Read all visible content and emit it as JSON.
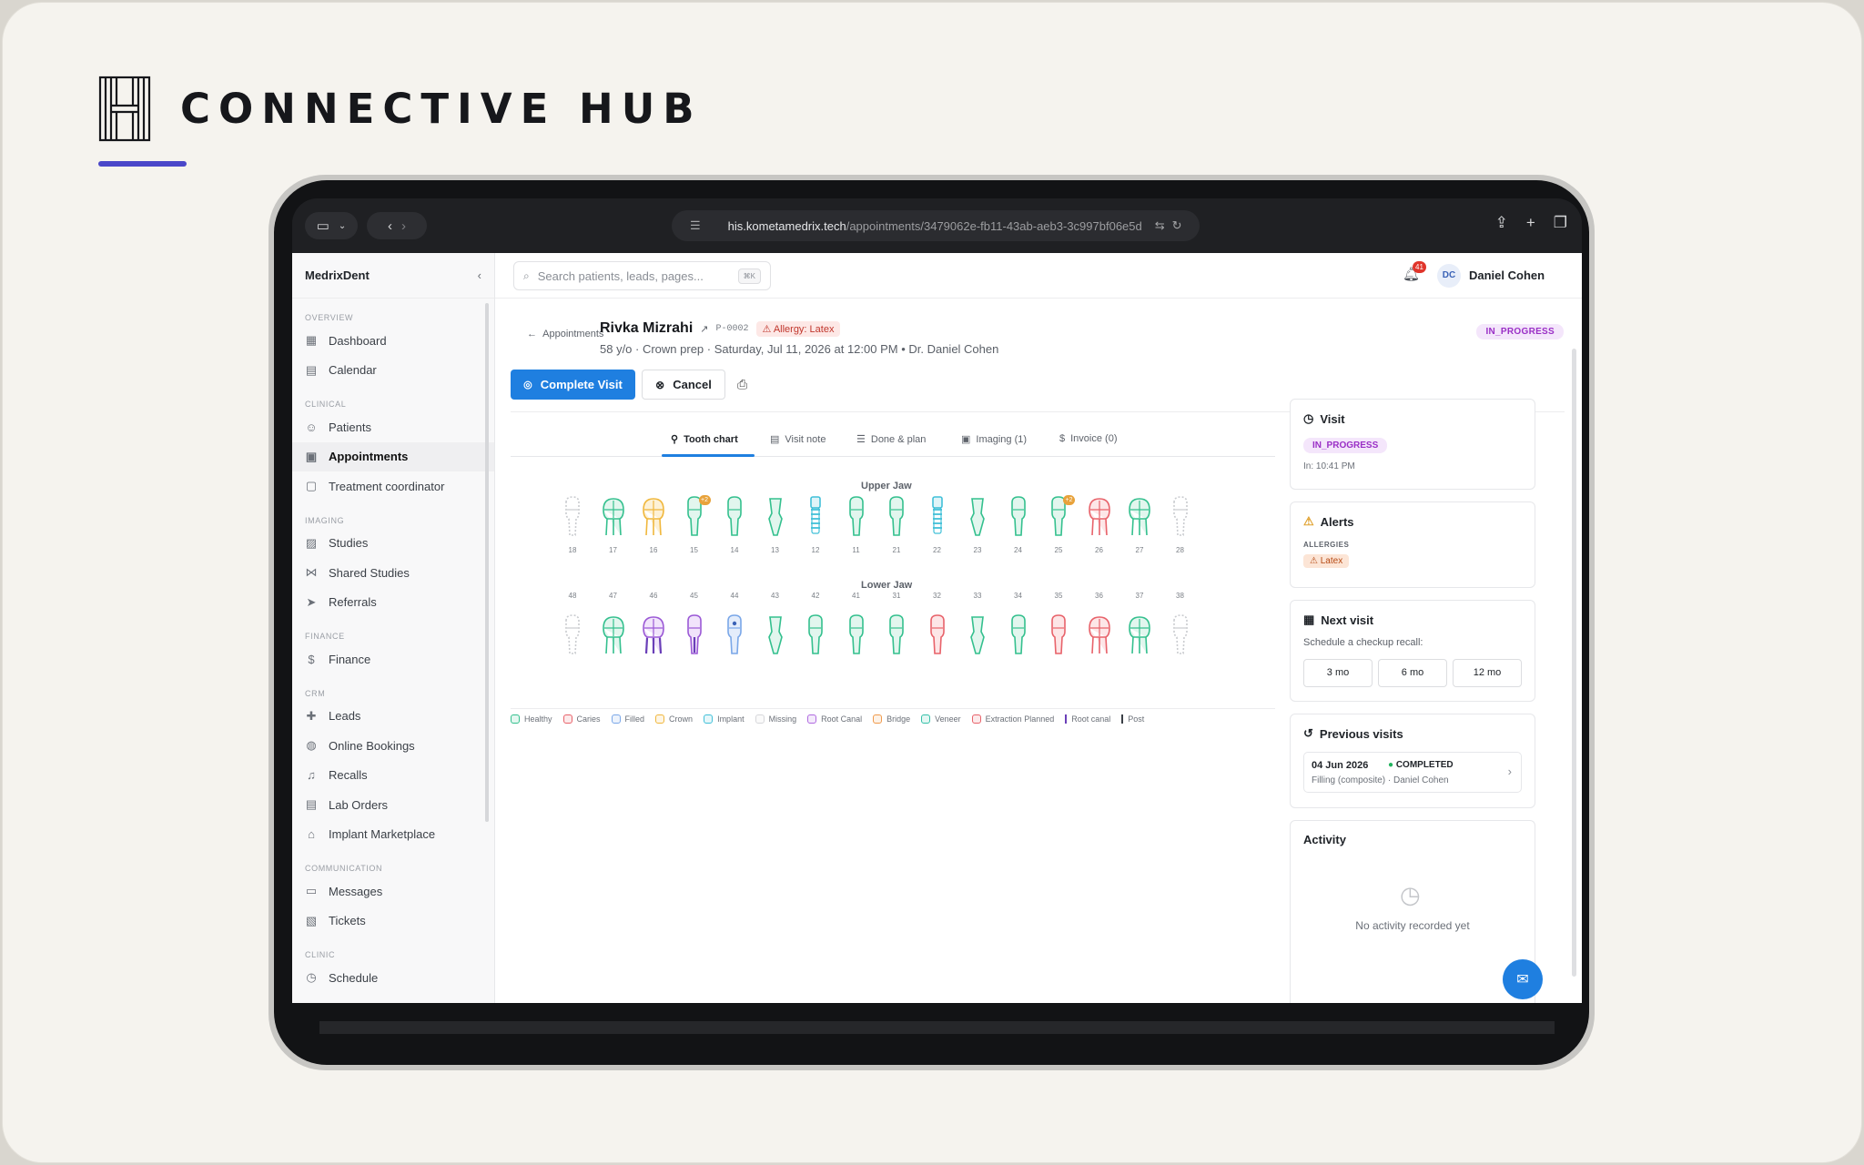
{
  "brand": {
    "name": "CONNECTIVE HUB",
    "underline_color": "#4a47c9"
  },
  "browser": {
    "url_host": "his.kometamedrix.tech",
    "url_path": "/appointments/3479062e-fb11-43ab-aeb3-3c997bf06e5d"
  },
  "sidebar": {
    "title": "MedrixDent",
    "sections": [
      {
        "label": "OVERVIEW",
        "items": [
          {
            "label": "Dashboard",
            "icon": "grid-icon"
          },
          {
            "label": "Calendar",
            "icon": "calendar-icon"
          }
        ]
      },
      {
        "label": "CLINICAL",
        "items": [
          {
            "label": "Patients",
            "icon": "users-icon"
          },
          {
            "label": "Appointments",
            "icon": "clipboard-icon",
            "active": true
          },
          {
            "label": "Treatment coordinator",
            "icon": "document-icon"
          }
        ]
      },
      {
        "label": "IMAGING",
        "items": [
          {
            "label": "Studies",
            "icon": "image-icon"
          },
          {
            "label": "Shared Studies",
            "icon": "share-icon"
          },
          {
            "label": "Referrals",
            "icon": "send-icon"
          }
        ]
      },
      {
        "label": "FINANCE",
        "items": [
          {
            "label": "Finance",
            "icon": "dollar-icon"
          }
        ]
      },
      {
        "label": "CRM",
        "items": [
          {
            "label": "Leads",
            "icon": "user-plus-icon"
          },
          {
            "label": "Online Bookings",
            "icon": "globe-icon"
          },
          {
            "label": "Recalls",
            "icon": "bell-icon"
          },
          {
            "label": "Lab Orders",
            "icon": "box-icon"
          },
          {
            "label": "Implant Marketplace",
            "icon": "store-icon"
          }
        ]
      },
      {
        "label": "COMMUNICATION",
        "items": [
          {
            "label": "Messages",
            "icon": "message-icon"
          },
          {
            "label": "Tickets",
            "icon": "ticket-icon"
          }
        ]
      },
      {
        "label": "CLINIC",
        "items": [
          {
            "label": "Schedule",
            "icon": "clock-icon"
          }
        ]
      }
    ]
  },
  "topbar": {
    "search_placeholder": "Search patients, leads, pages...",
    "shortcut": "⌘K",
    "notification_count": "41",
    "user_initials": "DC",
    "user_name": "Daniel Cohen"
  },
  "header": {
    "back_label": "Appointments",
    "patient_name": "Rivka Mizrahi",
    "patient_id": "P-0002",
    "allergy_label": "Allergy: Latex",
    "meta": "58 y/o · Crown prep · Saturday, Jul 11, 2026 at 12:00 PM • Dr. Daniel Cohen",
    "status": "IN_PROGRESS",
    "complete_label": "Complete Visit",
    "cancel_label": "Cancel"
  },
  "tabs": [
    {
      "label": "Tooth chart",
      "active": true
    },
    {
      "label": "Visit note"
    },
    {
      "label": "Done & plan"
    },
    {
      "label": "Imaging (1)"
    },
    {
      "label": "Invoice (0)"
    }
  ],
  "chart": {
    "upper_label": "Upper Jaw",
    "lower_label": "Lower Jaw",
    "upper": [
      {
        "n": "18",
        "s": "missing"
      },
      {
        "n": "17",
        "s": "healthy-molar"
      },
      {
        "n": "16",
        "s": "crown-molar"
      },
      {
        "n": "15",
        "s": "healthy",
        "marker": "+2"
      },
      {
        "n": "14",
        "s": "healthy"
      },
      {
        "n": "13",
        "s": "healthy-canine"
      },
      {
        "n": "12",
        "s": "implant"
      },
      {
        "n": "11",
        "s": "healthy"
      },
      {
        "n": "21",
        "s": "healthy"
      },
      {
        "n": "22",
        "s": "implant"
      },
      {
        "n": "23",
        "s": "healthy-canine"
      },
      {
        "n": "24",
        "s": "healthy"
      },
      {
        "n": "25",
        "s": "healthy",
        "marker": "+2"
      },
      {
        "n": "26",
        "s": "caries-molar"
      },
      {
        "n": "27",
        "s": "healthy-molar"
      },
      {
        "n": "28",
        "s": "missing"
      }
    ],
    "lower": [
      {
        "n": "48",
        "s": "missing"
      },
      {
        "n": "47",
        "s": "healthy-molar"
      },
      {
        "n": "46",
        "s": "rootcanal-molar"
      },
      {
        "n": "45",
        "s": "rootcanal"
      },
      {
        "n": "44",
        "s": "filled"
      },
      {
        "n": "43",
        "s": "healthy-canine"
      },
      {
        "n": "42",
        "s": "healthy"
      },
      {
        "n": "41",
        "s": "healthy"
      },
      {
        "n": "31",
        "s": "healthy"
      },
      {
        "n": "32",
        "s": "caries"
      },
      {
        "n": "33",
        "s": "healthy-canine"
      },
      {
        "n": "34",
        "s": "healthy"
      },
      {
        "n": "35",
        "s": "caries"
      },
      {
        "n": "36",
        "s": "caries-molar"
      },
      {
        "n": "37",
        "s": "healthy-molar"
      },
      {
        "n": "38",
        "s": "missing"
      }
    ]
  },
  "legend": [
    {
      "label": "Healthy",
      "color": "#34c08e"
    },
    {
      "label": "Caries",
      "color": "#e8626a"
    },
    {
      "label": "Filled",
      "color": "#7aa7e8"
    },
    {
      "label": "Crown",
      "color": "#f0b73c"
    },
    {
      "label": "Implant",
      "color": "#41c0d8"
    },
    {
      "label": "Missing",
      "color": "#d6d7da"
    },
    {
      "label": "Root Canal",
      "color": "#b06ae0"
    },
    {
      "label": "Bridge",
      "color": "#f09a4c"
    },
    {
      "label": "Veneer",
      "color": "#34c0a8"
    },
    {
      "label": "Extraction Planned",
      "color": "#e8626a"
    },
    {
      "label": "Root canal",
      "color": "#6a3fb8",
      "bar": true
    },
    {
      "label": "Post",
      "color": "#3a3f46",
      "bar": true
    }
  ],
  "visit_panel": {
    "title": "Visit",
    "status": "IN_PROGRESS",
    "in_time": "In: 10:41 PM"
  },
  "alerts_panel": {
    "title": "Alerts",
    "allergies_label": "ALLERGIES",
    "allergy": "Latex"
  },
  "next_visit_panel": {
    "title": "Next visit",
    "subtitle": "Schedule a checkup recall:",
    "options": [
      "3 mo",
      "6 mo",
      "12 mo"
    ]
  },
  "previous_visits_panel": {
    "title": "Previous visits",
    "date": "04 Jun 2026",
    "status": "COMPLETED",
    "detail": "Filling (composite) · Daniel Cohen"
  },
  "activity_panel": {
    "title": "Activity",
    "empty": "No activity recorded yet"
  }
}
